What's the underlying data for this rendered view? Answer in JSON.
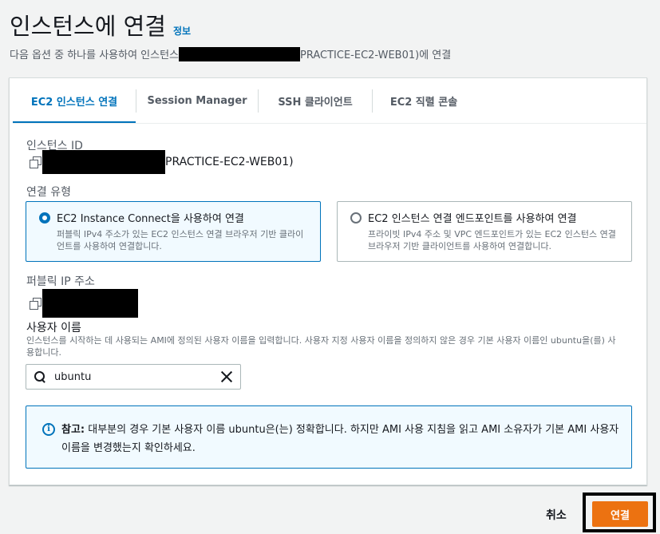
{
  "header": {
    "title": "인스턴스에 연결",
    "info_link": "정보",
    "subtitle_prefix": "다음 옵션 중 하나를 사용하여 인스턴스",
    "subtitle_suffix": "PRACTICE-EC2-WEB01)에 연결"
  },
  "tabs": [
    {
      "label": "EC2 인스턴스 연결",
      "active": true
    },
    {
      "label": "Session Manager",
      "active": false
    },
    {
      "label": "SSH 클라이언트",
      "active": false
    },
    {
      "label": "EC2 직렬 콘솔",
      "active": false
    }
  ],
  "instance_id": {
    "label": "인스턴스 ID",
    "value_suffix": "PRACTICE-EC2-WEB01)"
  },
  "connection_type": {
    "label": "연결 유형",
    "options": [
      {
        "title": "EC2 Instance Connect을 사용하여 연결",
        "description": "퍼블릭 IPv4 주소가 있는 EC2 인스턴스 연결 브라우저 기반 클라이언트를 사용하여 연결합니다.",
        "selected": true
      },
      {
        "title": "EC2 인스턴스 연결 엔드포인트를 사용하여 연결",
        "description": "프라이빗 IPv4 주소 및 VPC 엔드포인트가 있는 EC2 인스턴스 연결 브라우저 기반 클라이언트를 사용하여 연결합니다.",
        "selected": false
      }
    ]
  },
  "public_ip": {
    "label": "퍼블릭 IP 주소"
  },
  "username": {
    "label": "사용자 이름",
    "hint": "인스턴스를 시작하는 데 사용되는 AMI에 정의된 사용자 이름을 입력합니다. 사용자 지정 사용자 이름을 정의하지 않은 경우 기본 사용자 이름인 ubuntu을(를) 사용합니다.",
    "value": "ubuntu"
  },
  "alert": {
    "prefix": "참고:",
    "text": "대부분의 경우 기본 사용자 이름 ubuntu은(는) 정확합니다. 하지만 AMI 사용 지침을 읽고 AMI 소유자가 기본 AMI 사용자 이름을 변경했는지 확인하세요."
  },
  "footer": {
    "cancel_label": "취소",
    "connect_label": "연결"
  },
  "colors": {
    "accent": "#0073bb",
    "primary_button": "#ec7211"
  },
  "icons": [
    "copy-icon",
    "search-icon",
    "clear-icon",
    "info-icon"
  ]
}
